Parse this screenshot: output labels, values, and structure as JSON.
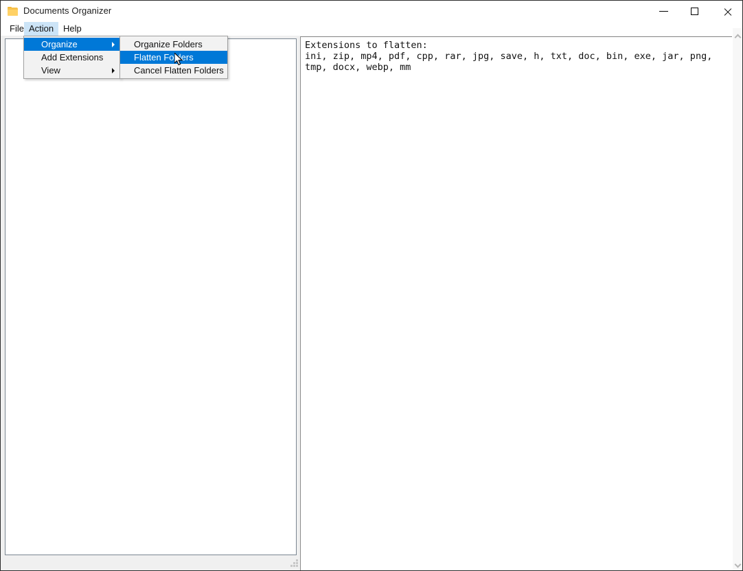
{
  "window": {
    "title": "Documents Organizer",
    "icon": "folder-icon",
    "controls": {
      "minimize": "minimize-icon",
      "maximize": "maximize-icon",
      "close": "close-icon"
    }
  },
  "menubar": {
    "items": [
      {
        "label": "File",
        "active": false
      },
      {
        "label": "Action",
        "active": true
      },
      {
        "label": "Help",
        "active": false
      }
    ]
  },
  "dropdown": {
    "items": [
      {
        "label": "Organize",
        "has_submenu": true,
        "selected": true
      },
      {
        "label": "Add Extensions",
        "has_submenu": false,
        "selected": false
      },
      {
        "label": "View",
        "has_submenu": true,
        "selected": false
      }
    ]
  },
  "submenu": {
    "items": [
      {
        "label": "Organize Folders",
        "selected": false
      },
      {
        "label": "Flatten Folders",
        "selected": true
      },
      {
        "label": "Cancel Flatten Folders",
        "selected": false
      }
    ]
  },
  "left_panel": {
    "content": ""
  },
  "log_panel": {
    "heading": "Extensions to flatten:",
    "extensions": "ini, zip, mp4, pdf, cpp, rar, jpg, save, h, txt, doc, bin, exe, jar, png, tmp, docx, webp, mm",
    "text": "Extensions to flatten:\nini, zip, mp4, pdf, cpp, rar, jpg, save, h, txt, doc, bin, exe, jar, png, tmp, docx, webp, mm"
  },
  "scrollbar": {
    "up_arrow": "chevron-up-icon",
    "down_arrow": "chevron-down-icon"
  },
  "colors": {
    "accent": "#0078d7",
    "menu_highlight": "#cce4f7",
    "menu_bg": "#f2f2f2",
    "window_bg": "#f0f0f0",
    "folder_icon": "#ffd166"
  }
}
